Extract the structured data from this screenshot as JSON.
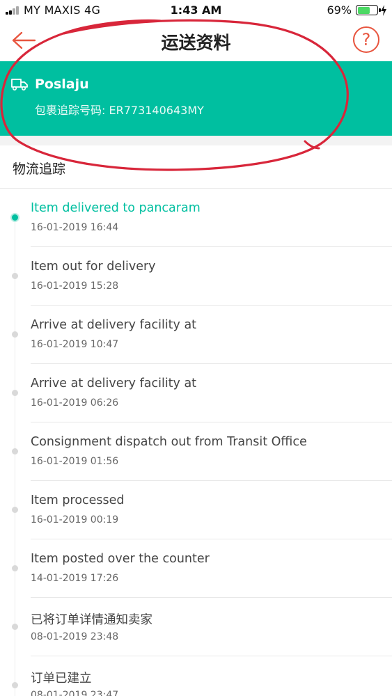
{
  "status_bar": {
    "carrier": "MY MAXIS   4G",
    "time": "1:43 AM",
    "battery": "69%",
    "battery_level": 0.69
  },
  "nav": {
    "title": "运送资料",
    "back_icon": "back-arrow-icon",
    "help_label": "?"
  },
  "carrier_card": {
    "icon": "truck-icon",
    "name": "Poslaju",
    "tracking_label": "包裹追踪号码: ",
    "tracking_number": "ER773140643MY"
  },
  "section_title": "物流追踪",
  "events": [
    {
      "title": "Item delivered to pancaram",
      "time": "16-01-2019 16:44",
      "active": true
    },
    {
      "title": "Item out for delivery",
      "time": "16-01-2019 15:28"
    },
    {
      "title": "Arrive at delivery facility at",
      "time": "16-01-2019 10:47"
    },
    {
      "title": "Arrive at delivery facility at",
      "time": "16-01-2019 06:26"
    },
    {
      "title": "Consignment dispatch out from Transit Office",
      "time": "16-01-2019 01:56"
    },
    {
      "title": "Item processed",
      "time": "16-01-2019 00:19"
    },
    {
      "title": "Item posted over the counter",
      "time": "14-01-2019 17:26"
    },
    {
      "title": "已将订单详情通知卖家",
      "time": "08-01-2019 23:48"
    },
    {
      "title": "订单已建立",
      "time": "08-01-2019 23:47"
    }
  ],
  "colors": {
    "accent": "#00bfa0",
    "help": "#e8553f",
    "annotation": "#d8263a"
  }
}
